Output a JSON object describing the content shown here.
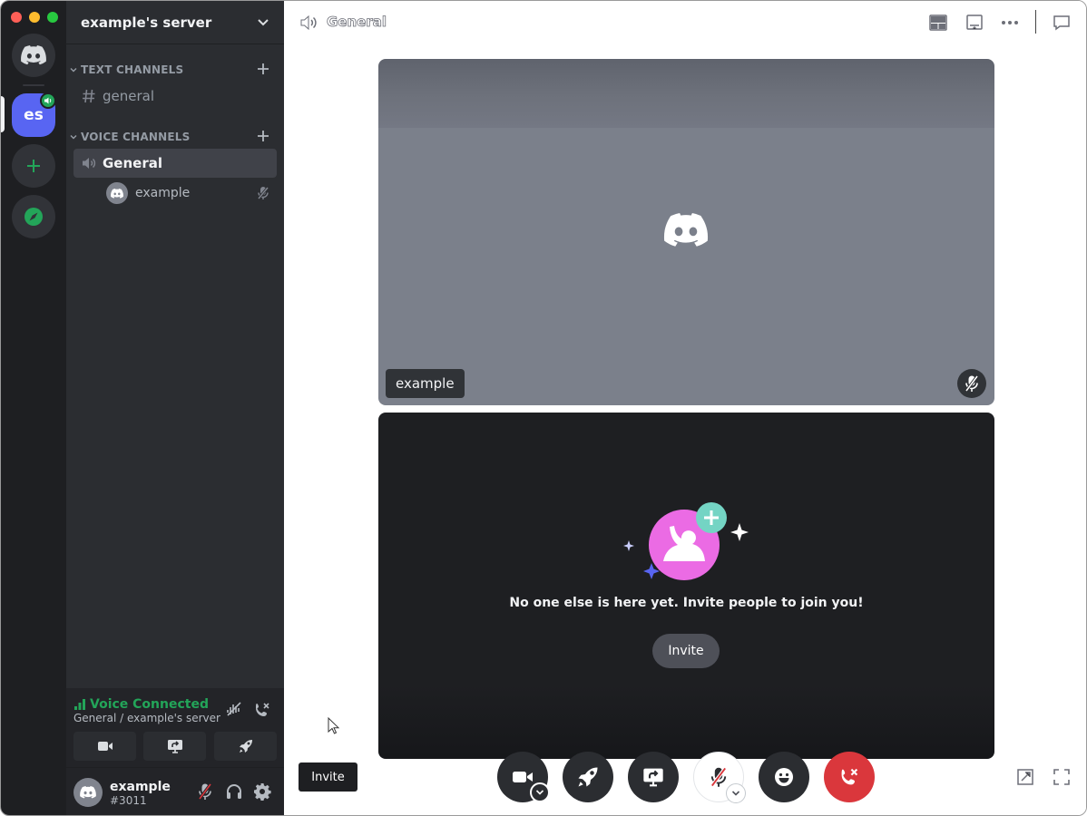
{
  "server": {
    "name": "example's server",
    "abbrev": "es"
  },
  "channels": {
    "text_category": "TEXT CHANNELS",
    "voice_category": "VOICE CHANNELS",
    "text": [
      {
        "name": "general"
      }
    ],
    "voice": [
      {
        "name": "General",
        "users": [
          {
            "name": "example"
          }
        ]
      }
    ]
  },
  "voice_panel": {
    "status": "Voice Connected",
    "location": "General / example's server"
  },
  "user": {
    "name": "example",
    "tag": "#3011"
  },
  "topbar": {
    "title": "General"
  },
  "stage": {
    "tile_user_name": "example",
    "empty_message": "No one else is here yet. Invite people to join you!",
    "empty_invite_label": "Invite"
  },
  "invite_button_label": "Invite",
  "colors": {
    "brand": "#5865f2",
    "green": "#23a559",
    "red": "#da373c",
    "pink": "#eb6be4",
    "teal": "#74d4c4"
  }
}
